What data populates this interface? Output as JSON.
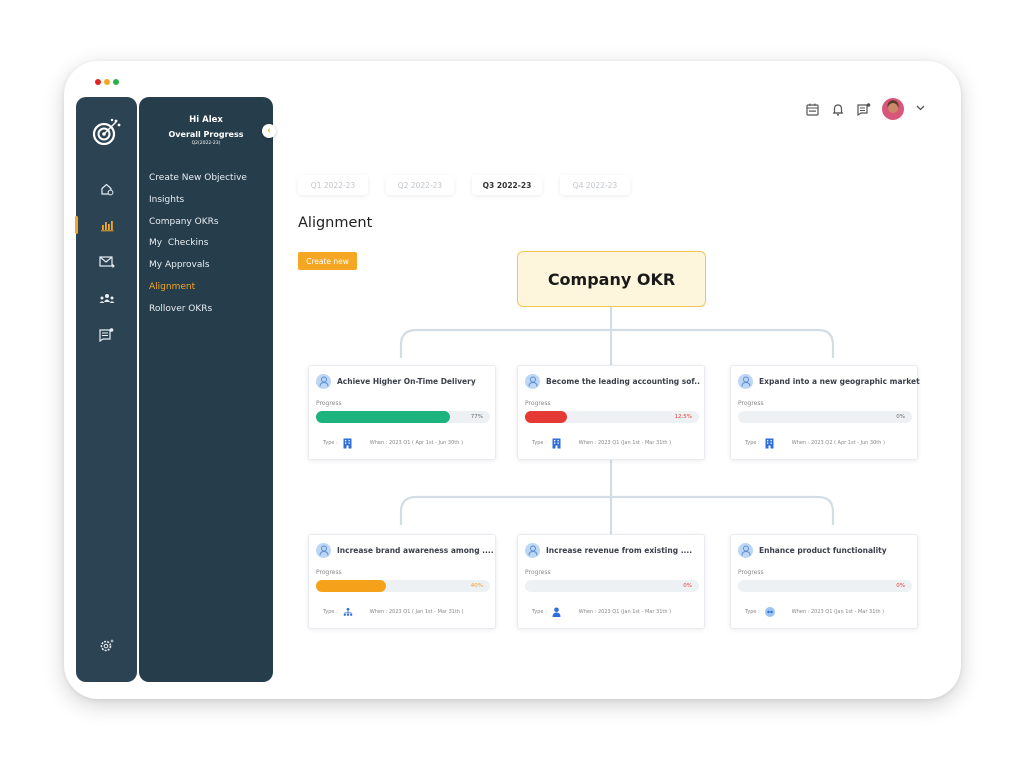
{
  "window": {
    "controls": [
      {
        "name": "close",
        "color": "#e02424"
      },
      {
        "name": "minimize",
        "color": "#f5a623"
      },
      {
        "name": "maximize",
        "color": "#2ab24a"
      }
    ]
  },
  "colors": {
    "accent": "#f5a623",
    "rail_bg": "#2c4354",
    "panel_bg": "#263d4b",
    "green": "#1db37c",
    "red": "#e53935",
    "orange": "#f5a21a",
    "type_blue": "#2f6fdb"
  },
  "rail": {
    "icons": [
      {
        "name": "logo-target-icon"
      },
      {
        "name": "home-settings-icon"
      },
      {
        "name": "bar-chart-icon",
        "active": true
      },
      {
        "name": "mail-forward-icon"
      },
      {
        "name": "team-icon"
      },
      {
        "name": "message-notification-icon"
      },
      {
        "name": "settings-gear-icon"
      }
    ]
  },
  "panel": {
    "greeting": "Hi Alex",
    "subtitle": "Overall Progress",
    "period": "Q2(2022-23)",
    "collapse_glyph": "‹",
    "menu": [
      {
        "label": "Create New Objective",
        "active": false
      },
      {
        "label": "Insights",
        "active": false
      },
      {
        "label": "Company OKRs",
        "active": false
      },
      {
        "label": "My  Checkins",
        "active": false
      },
      {
        "label": "My Approvals",
        "active": false
      },
      {
        "label": "Alignment",
        "active": true
      },
      {
        "label": "Rollover OKRs",
        "active": false
      }
    ]
  },
  "topbar": {
    "icons": [
      "calendar-icon",
      "bell-icon",
      "messages-icon"
    ],
    "profile_chevron": "⌄"
  },
  "main": {
    "tabs": [
      {
        "label": "Q1 2022-23",
        "active": false
      },
      {
        "label": "Q2 2022-23",
        "active": false
      },
      {
        "label": "Q3 2022-23",
        "active": true
      },
      {
        "label": "Q4 2022-23",
        "active": false
      }
    ],
    "title": "Alignment",
    "create_button": "Create new",
    "root_node": "Company OKR",
    "progress_label": "Progress",
    "type_label": "Type :",
    "cards": [
      {
        "title": "Achieve Higher On-Time Delivery",
        "progress": 77,
        "progress_text": "77%",
        "color": "#1db37c",
        "pct_color": "#666666",
        "type": "building",
        "when": "When : 2023 Q1 ( Apr 1st - Jun 30th )"
      },
      {
        "title": "Become the leading accounting sof..",
        "progress": 12.5,
        "progress_text": "12.5%",
        "color": "#e53935",
        "pct_color": "#e53935",
        "type": "building",
        "when": "When : 2023 Q1 (Jan 1st - Mar 31th )"
      },
      {
        "title": "Expand into a new geographic market",
        "progress": 0,
        "progress_text": "0%",
        "color": "#1db37c",
        "pct_color": "#666666",
        "type": "building",
        "when": "When : 2023 Q2 ( Apr 1st - Jun 30th )"
      },
      {
        "title": "Increase brand awareness among ....",
        "progress": 40,
        "progress_text": "40%",
        "color": "#f5a21a",
        "pct_color": "#f5a21a",
        "type": "team",
        "when": "When : 2023 Q1 ( Jan 1st - Mar 31th )"
      },
      {
        "title": "Increase revenue from existing ....",
        "progress": 0,
        "progress_text": "0%",
        "color": "#e53935",
        "pct_color": "#e53935",
        "type": "person",
        "when": "When : 2023 Q1 (Jan 1st - Mar 31th )"
      },
      {
        "title": "Enhance product functionality",
        "progress": 0,
        "progress_text": "0%",
        "color": "#e53935",
        "pct_color": "#e53935",
        "type": "group-badge",
        "when": "When : 2023 Q1 (Jan 1st - Mar 31th )"
      }
    ]
  }
}
